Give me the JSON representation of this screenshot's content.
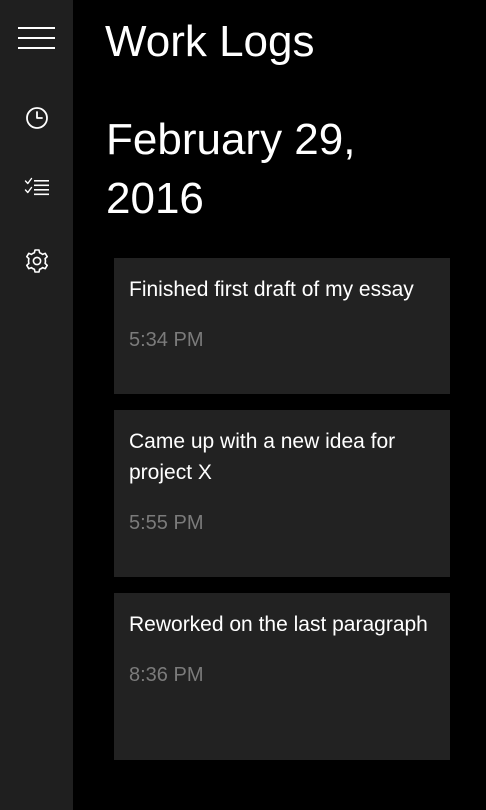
{
  "header": {
    "title": "Work Logs"
  },
  "sidebar": {
    "items": [
      {
        "icon": "hamburger-menu-icon"
      },
      {
        "icon": "clock-icon"
      },
      {
        "icon": "checklist-icon"
      },
      {
        "icon": "gear-icon"
      }
    ]
  },
  "main": {
    "date_heading": "February 29, 2016",
    "logs": [
      {
        "text": "Finished first draft of my essay",
        "time": "5:34 PM"
      },
      {
        "text": "Came up with a new idea for project X",
        "time": "5:55 PM"
      },
      {
        "text": "Reworked on the last paragraph",
        "time": "8:36 PM"
      }
    ]
  },
  "colors": {
    "background": "#000000",
    "sidebar": "#1f1f1f",
    "card": "#222222",
    "primary_text": "#ffffff",
    "secondary_text": "#7b7b7b"
  }
}
